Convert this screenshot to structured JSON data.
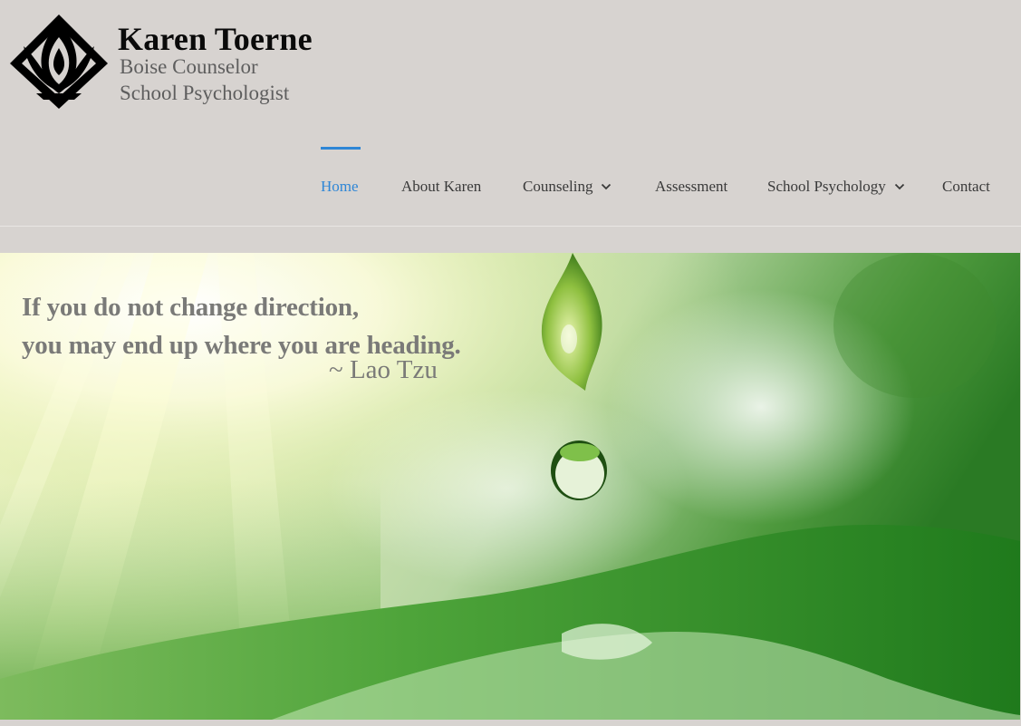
{
  "brand": {
    "name": "Karen Toerne",
    "subtitle_line1": "Boise Counselor",
    "subtitle_line2": "School Psychologist",
    "logo_icon": "lotus-icon"
  },
  "nav": {
    "items": [
      {
        "label": "Home",
        "active": true,
        "has_dropdown": false
      },
      {
        "label": "About Karen",
        "active": false,
        "has_dropdown": false
      },
      {
        "label": "Counseling",
        "active": false,
        "has_dropdown": true
      },
      {
        "label": "Assessment",
        "active": false,
        "has_dropdown": false
      },
      {
        "label": "School Psychology",
        "active": false,
        "has_dropdown": true
      },
      {
        "label": "Contact",
        "active": false,
        "has_dropdown": false
      }
    ]
  },
  "hero": {
    "quote_line1": "If you do not change direction,",
    "quote_line2": "you may end up where you are heading.",
    "author": "~ Lao Tzu"
  },
  "colors": {
    "background": "#d7d3d0",
    "accent": "#2e86d6",
    "quote_text": "#7a7a78"
  }
}
